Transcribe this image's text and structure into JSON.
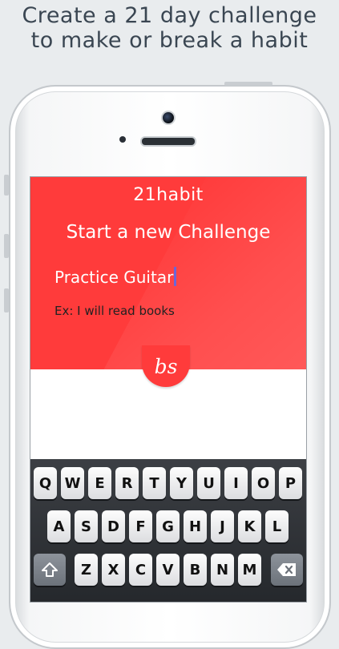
{
  "promo": {
    "line1": "Create a 21 day challenge",
    "line2": "to make or break a habit"
  },
  "app": {
    "name": "21habit",
    "screen_title": "Start a new Challenge",
    "habit_input": {
      "value": "Practice Guitar",
      "placeholder": ""
    },
    "example_hint": "Ex: I will read books",
    "logo_text": "bs"
  },
  "keyboard": {
    "row1": [
      "Q",
      "W",
      "E",
      "R",
      "T",
      "Y",
      "U",
      "I",
      "O",
      "P"
    ],
    "row2": [
      "A",
      "S",
      "D",
      "F",
      "G",
      "H",
      "J",
      "K",
      "L"
    ],
    "row3": [
      "Z",
      "X",
      "C",
      "V",
      "B",
      "N",
      "M"
    ],
    "shift_icon": "shift-arrow-icon",
    "delete_icon": "delete-backspace-icon"
  },
  "colors": {
    "accent_red": "#ff3b3b",
    "caret": "#6b66d8"
  }
}
